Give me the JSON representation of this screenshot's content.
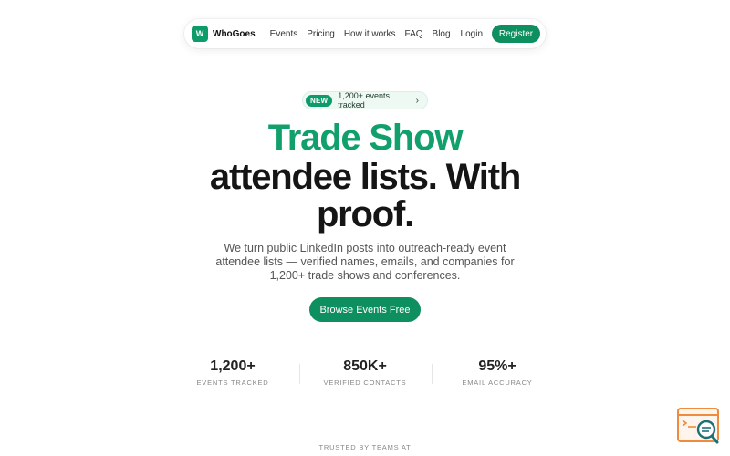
{
  "nav": {
    "logo_letter": "W",
    "brand": "WhoGoes",
    "links": [
      "Events",
      "Pricing",
      "How it works",
      "FAQ",
      "Blog"
    ],
    "login": "Login",
    "register": "Register"
  },
  "badge": {
    "tag": "NEW",
    "text": "1,200+ events tracked",
    "chevron": "›"
  },
  "hero": {
    "line1": "Trade Show",
    "line2": "attendee lists. With",
    "line3": "proof.",
    "subtitle": "We turn public LinkedIn posts into outreach-ready event attendee lists — verified names, emails, and companies for 1,200+ trade shows and conferences.",
    "cta": "Browse Events Free"
  },
  "stats": [
    {
      "value": "1,200+",
      "label": "EVENTS TRACKED"
    },
    {
      "value": "850K+",
      "label": "VERIFIED CONTACTS"
    },
    {
      "value": "95%+",
      "label": "EMAIL ACCURACY"
    }
  ],
  "trusted": "TRUSTED BY TEAMS AT",
  "colors": {
    "accent": "#0e8f5f",
    "headline_green": "#11a06b",
    "widget_orange": "#f08a3c",
    "widget_teal": "#1f6f7a"
  },
  "icons": {
    "widget": "search-window-icon"
  }
}
